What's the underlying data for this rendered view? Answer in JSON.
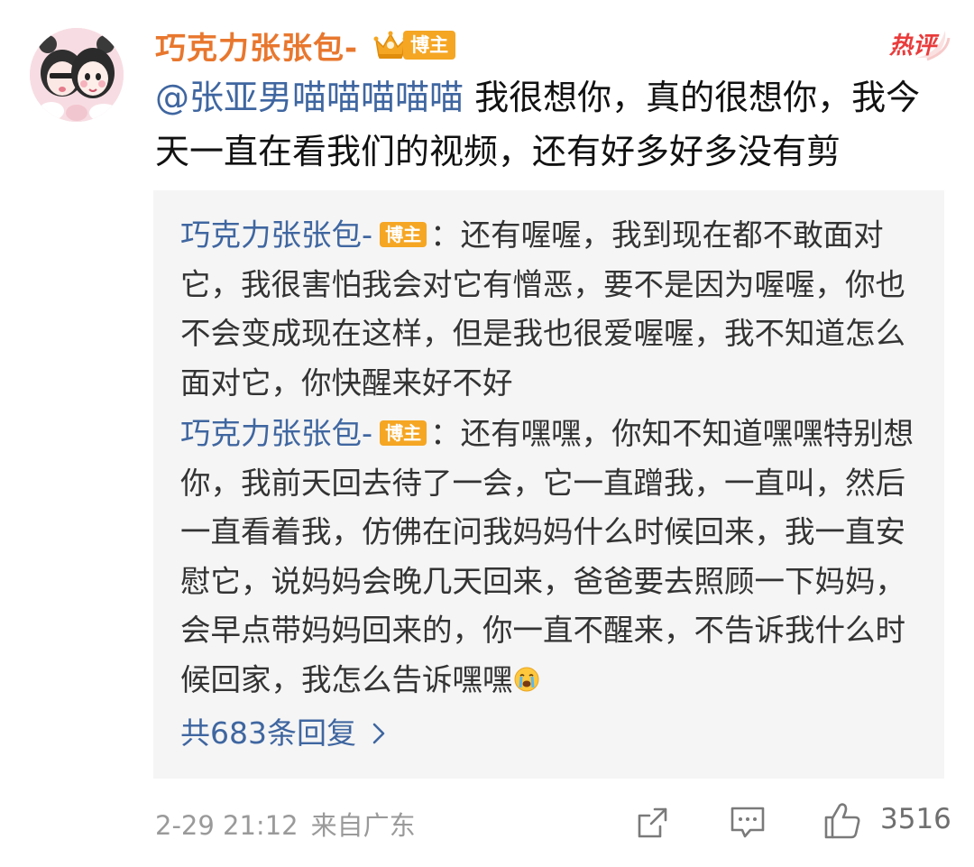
{
  "comment": {
    "username": "巧克力张张包-",
    "badge_label": "博主",
    "hot_label": "热评",
    "mention": "@张亚男喵喵喵喵喵",
    "text": " 我很想你，真的很想你，我今天一直在看我们的视频，还有好多好多没有剪"
  },
  "replies": [
    {
      "username": "巧克力张张包-",
      "badge_label": "博主",
      "separator": "：",
      "text": "还有喔喔，我到现在都不敢面对它，我很害怕我会对它有憎恶，要不是因为喔喔，你也不会变成现在这样，但是我也很爱喔喔，我不知道怎么面对它，你快醒来好不好"
    },
    {
      "username": "巧克力张张包-",
      "badge_label": "博主",
      "separator": "：",
      "text": "还有嘿嘿，你知不知道嘿嘿特别想你，我前天回去待了一会，它一直蹭我，一直叫，然后一直看着我，仿佛在问我妈妈什么时候回来，我一直安慰它，说妈妈会晚几天回来，爸爸要去照顾一下妈妈，会早点带妈妈回来的，你一直不醒来，不告诉我什么时候回家，我怎么告诉嘿嘿",
      "emoji": "crying-face-icon"
    }
  ],
  "more_replies_label": "共683条回复",
  "footer": {
    "date": "2-29 21:12",
    "location": "来自广东",
    "like_count": "3516"
  },
  "icons": {
    "badge": "crown-icon",
    "share": "share-icon",
    "comment": "comment-icon",
    "like": "thumbs-up-icon",
    "chevron": "chevron-right-icon"
  },
  "colors": {
    "username": "#e8772e",
    "link": "#3f66a0",
    "badge": "#f5a623",
    "hot": "#ea3b3b",
    "reply_bg": "#f5f5f5",
    "meta": "#9a9a9a"
  }
}
